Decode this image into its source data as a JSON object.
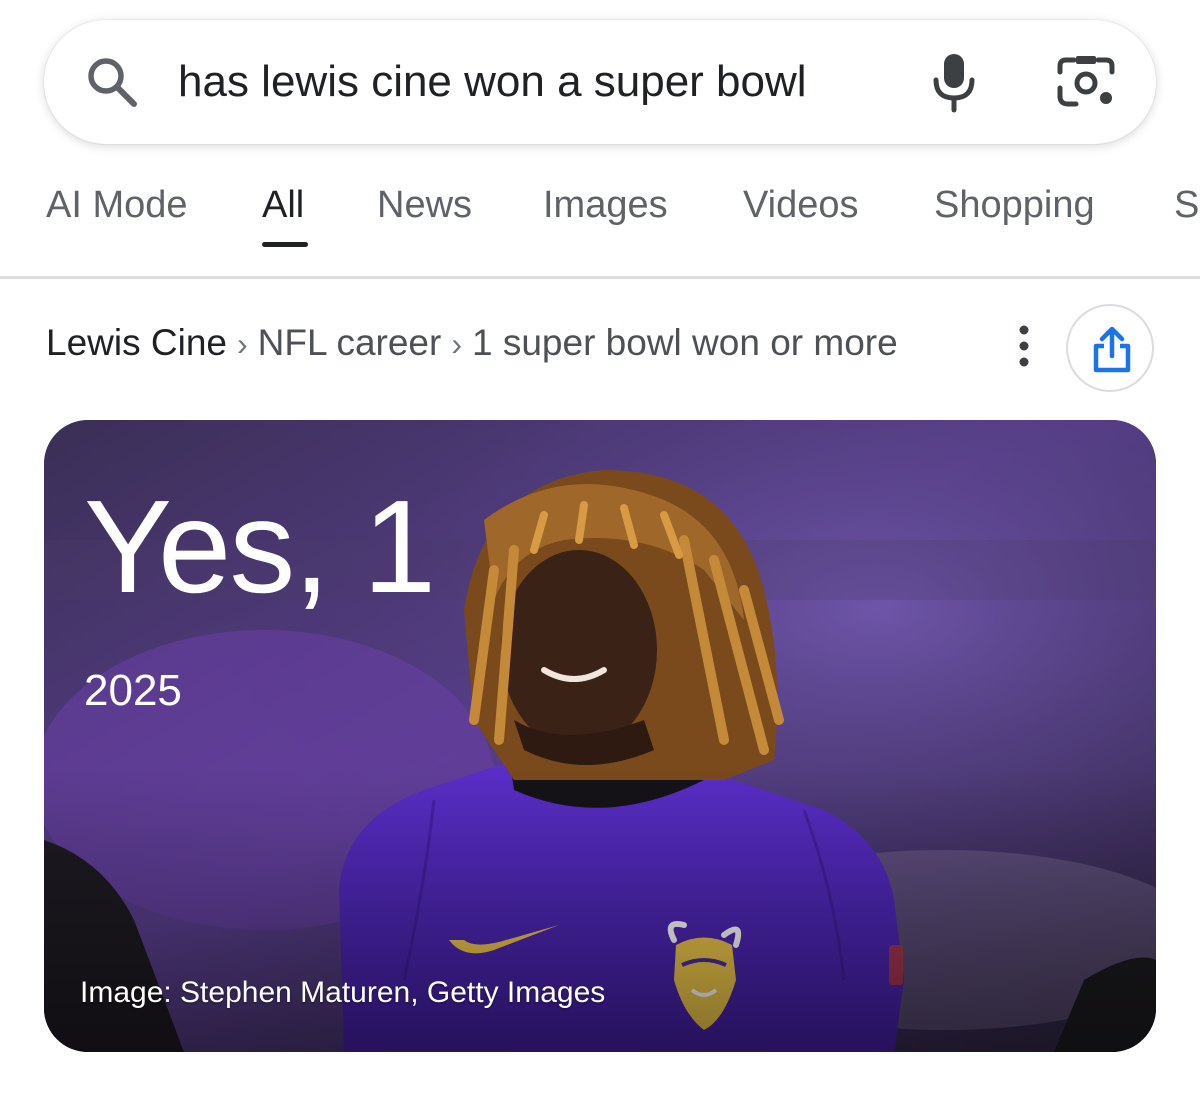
{
  "search": {
    "query": "has lewis cine won a super bowl",
    "search_icon": "search-icon",
    "mic_icon": "microphone-icon",
    "lens_icon": "camera-lens-icon"
  },
  "tabs": [
    {
      "label": "AI Mode",
      "active": false
    },
    {
      "label": "All",
      "active": true
    },
    {
      "label": "News",
      "active": false
    },
    {
      "label": "Images",
      "active": false
    },
    {
      "label": "Videos",
      "active": false
    },
    {
      "label": "Shopping",
      "active": false
    },
    {
      "label": "S",
      "active": false
    }
  ],
  "breadcrumb": {
    "items": [
      "Lewis Cine",
      "NFL career",
      "1 super bowl won or more"
    ],
    "separator": "›",
    "more_icon": "more-vert-icon",
    "share_icon": "share-icon"
  },
  "answer": {
    "headline": "Yes, 1",
    "year": "2025",
    "image_credit": "Image: Stephen Maturen, Getty Images"
  },
  "colors": {
    "text_primary": "#202124",
    "text_secondary": "#5f6368",
    "share_accent": "#1a73e8",
    "card_purple": "#4b2ea0",
    "jersey_gold": "#f0c84a"
  }
}
